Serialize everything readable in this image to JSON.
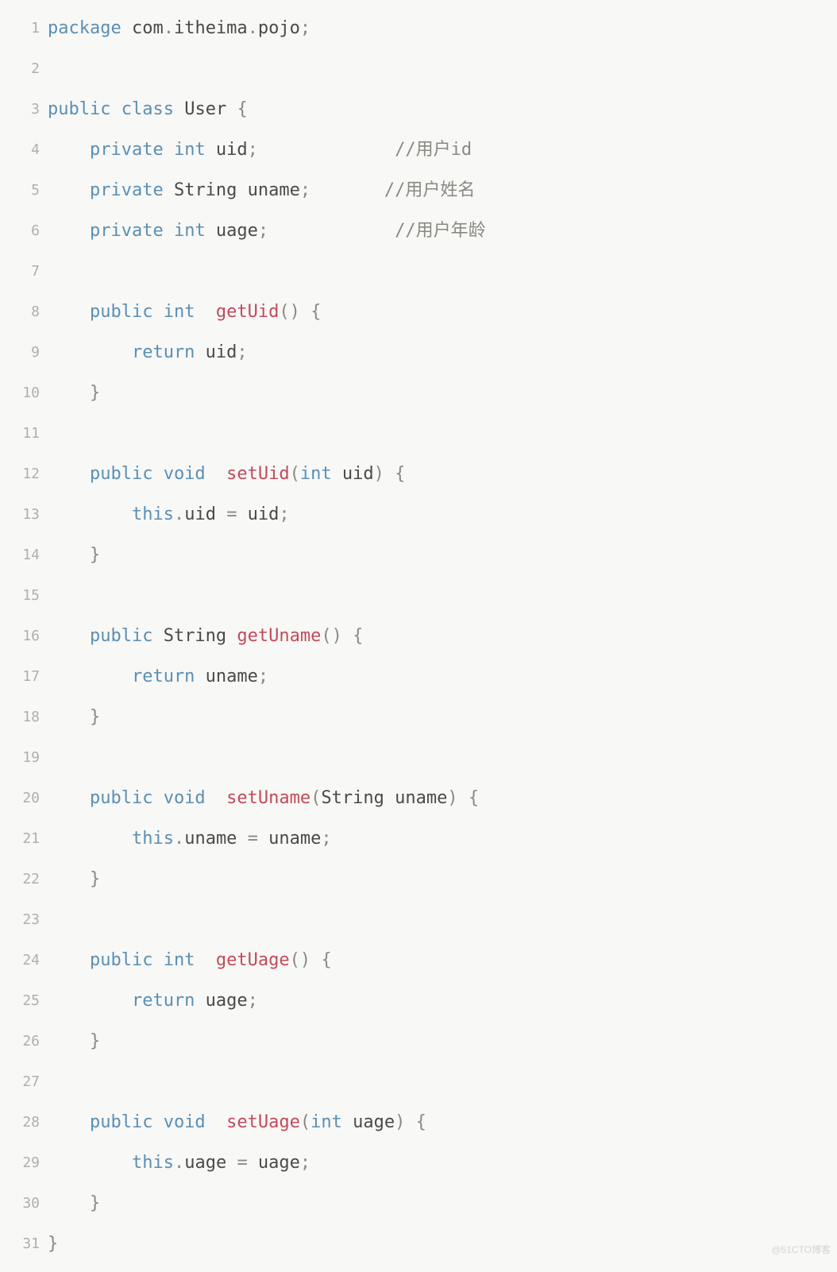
{
  "watermark": "@51CTO博客",
  "gutter": [
    "1",
    "2",
    "3",
    "4",
    "5",
    "6",
    "7",
    "8",
    "9",
    "10",
    "11",
    "12",
    "13",
    "14",
    "15",
    "16",
    "17",
    "18",
    "19",
    "20",
    "21",
    "22",
    "23",
    "24",
    "25",
    "26",
    "27",
    "28",
    "29",
    "30",
    "31"
  ],
  "lines": {
    "l1": {
      "t1": "package",
      "t2": " com",
      "t3": ".",
      "t4": "itheima",
      "t5": ".",
      "t6": "pojo",
      "t7": ";"
    },
    "l3": {
      "t1": "public",
      "t2": " class",
      "t3": " User ",
      "t4": "{"
    },
    "l4": {
      "t1": "    private",
      "t2": " int",
      "t3": " uid",
      "t4": ";",
      "t5": "             ",
      "t6": "//用户id"
    },
    "l5": {
      "t1": "    private",
      "t2": " String uname",
      "t3": ";",
      "t4": "       ",
      "t5": "//用户姓名"
    },
    "l6": {
      "t1": "    private",
      "t2": " int",
      "t3": " uage",
      "t4": ";",
      "t5": "            ",
      "t6": "//用户年龄"
    },
    "l8": {
      "t1": "    public",
      "t2": " int",
      "t3": " getUid",
      "t4": "()",
      "t5": " {"
    },
    "l9": {
      "t1": "        return",
      "t2": " uid",
      "t3": ";"
    },
    "l10": {
      "t1": "    }"
    },
    "l12": {
      "t1": "    public",
      "t2": " void",
      "t3": " setUid",
      "t4": "(",
      "t5": "int",
      "t6": " uid",
      "t7": ")",
      "t8": " {"
    },
    "l13": {
      "t1": "        this",
      "t2": ".",
      "t3": "uid ",
      "t4": "=",
      "t5": " uid",
      "t6": ";"
    },
    "l14": {
      "t1": "    }"
    },
    "l16": {
      "t1": "    public",
      "t2": " String ",
      "t3": "getUname",
      "t4": "()",
      "t5": " {"
    },
    "l17": {
      "t1": "        return",
      "t2": " uname",
      "t3": ";"
    },
    "l18": {
      "t1": "    }"
    },
    "l20": {
      "t1": "    public",
      "t2": " void",
      "t3": " setUname",
      "t4": "(",
      "t5": "String uname",
      "t6": ")",
      "t7": " {"
    },
    "l21": {
      "t1": "        this",
      "t2": ".",
      "t3": "uname ",
      "t4": "=",
      "t5": " uname",
      "t6": ";"
    },
    "l22": {
      "t1": "    }"
    },
    "l24": {
      "t1": "    public",
      "t2": " int",
      "t3": " getUage",
      "t4": "()",
      "t5": " {"
    },
    "l25": {
      "t1": "        return",
      "t2": " uage",
      "t3": ";"
    },
    "l26": {
      "t1": "    }"
    },
    "l28": {
      "t1": "    public",
      "t2": " void",
      "t3": " setUage",
      "t4": "(",
      "t5": "int",
      "t6": " uage",
      "t7": ")",
      "t8": " {"
    },
    "l29": {
      "t1": "        this",
      "t2": ".",
      "t3": "uage ",
      "t4": "=",
      "t5": " uage",
      "t6": ";"
    },
    "l30": {
      "t1": "    }"
    },
    "l31": {
      "t1": "}"
    }
  }
}
